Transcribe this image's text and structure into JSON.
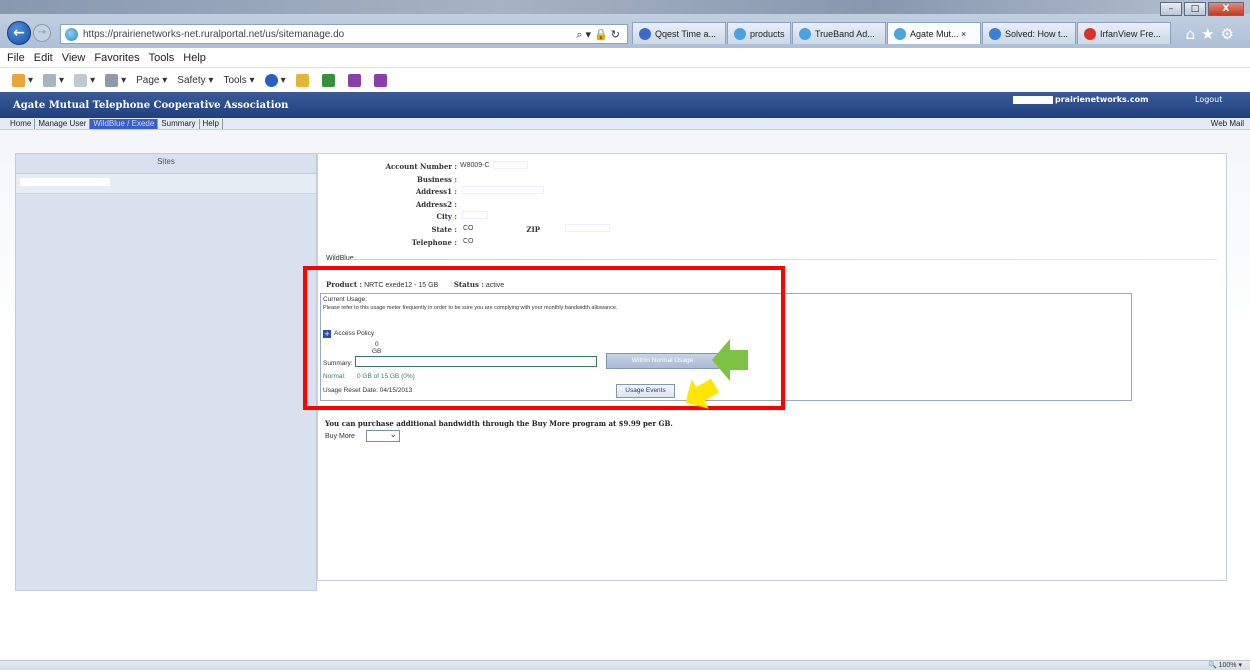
{
  "browser": {
    "url": "https://prairienetworks-net.ruralportal.net/us/sitemanage.do",
    "tabs": [
      {
        "label": "Qqest Time a...",
        "color": "#3a6bc9"
      },
      {
        "label": "products",
        "color": "#4aa3df"
      },
      {
        "label": "TrueBand Ad...",
        "color": "#4aa3df"
      },
      {
        "label": "Agate Mut... ×",
        "color": "#4aa3df",
        "active": true
      },
      {
        "label": "Solved: How t...",
        "color": "#3b7fd4"
      },
      {
        "label": "IrfanView Fre...",
        "color": "#d8312a"
      }
    ],
    "menu": [
      "File",
      "Edit",
      "View",
      "Favorites",
      "Tools",
      "Help"
    ],
    "commands": [
      "Page ▾",
      "Safety ▾",
      "Tools ▾"
    ],
    "zoom": "100%"
  },
  "header": {
    "org": "Agate Mutual Telephone Cooperative Association",
    "email": "prairienetworks.com",
    "logout": "Logout"
  },
  "nav": {
    "items": [
      "Home",
      "Manage User",
      "WildBlue / Exede",
      "Summary",
      "Help"
    ],
    "webmail": "Web Mail"
  },
  "sites": {
    "header": "Sites"
  },
  "account": {
    "number_label": "Account Number :",
    "number_value": "W8009-C",
    "business_label": "Business :",
    "address1_label": "Address1 :",
    "address2_label": "Address2 :",
    "city_label": "City :",
    "state_label": "State :",
    "state_value": "CO",
    "zip_label": "ZIP",
    "telephone_label": "Telephone :",
    "telephone_value": "CO"
  },
  "wildblue": {
    "section": "WildBlue",
    "product_label": "Product :",
    "product_value": "NRTC exede12 - 15 GB",
    "status_label": "Status :",
    "status_value": "active",
    "current_usage": "Current Usage:",
    "notice": "Please refer to this usage meter frequently in order to be sure you are complying with your monthly bandwidth allowance.",
    "access_policy": "Access Policy",
    "meter_value": "0",
    "meter_unit": "GB",
    "summary_label": "Summary:",
    "usage_fraction": 0,
    "within_btn": "Within Normal Usage",
    "normal_label": "Normal:",
    "normal_value": "0 GB of 15 GB (0%)",
    "usage_events_btn": "Usage Events",
    "reset_date": "Usage Reset Date: 04/15/2013"
  },
  "buymore": {
    "text": "You can purchase additional bandwidth through the Buy More program at $9.99 per GB.",
    "label": "Buy More"
  },
  "colors": {
    "highlight_box": "#ff0000",
    "green_arrow": "#7dc242",
    "yellow_arrow": "#ffe600",
    "header_bg": "#2a4785"
  }
}
